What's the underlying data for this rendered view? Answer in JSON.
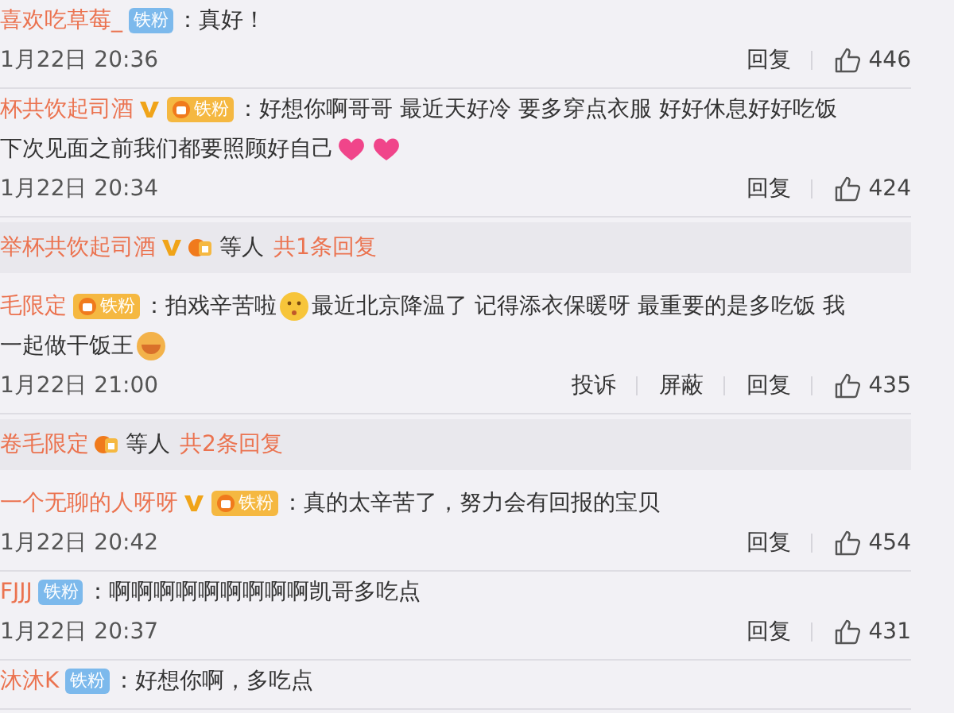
{
  "separator": "：",
  "comments": [
    {
      "kind": "comment",
      "user": "喜欢吃草莓_",
      "verified": false,
      "badge": {
        "kind": "blue",
        "label": "铁粉"
      },
      "lines": [
        [
          {
            "kind": "text",
            "text": "真好！"
          }
        ]
      ],
      "time": "1月22日 20:36",
      "actions": [
        "回复"
      ],
      "likes": "446"
    },
    {
      "kind": "comment",
      "user": "杯共饮起司酒",
      "verified": true,
      "badge": {
        "kind": "gold",
        "label": "铁粉"
      },
      "lines": [
        [
          {
            "kind": "text",
            "text": "好想你啊哥哥 最近天好冷 要多穿点衣服 好好休息好好吃饭"
          }
        ],
        [
          {
            "kind": "text",
            "text": "下次见面之前我们都要照顾好自己"
          },
          {
            "kind": "heart"
          },
          {
            "kind": "heart"
          }
        ]
      ],
      "time": "1月22日 20:34",
      "actions": [
        "回复"
      ],
      "likes": "424"
    },
    {
      "kind": "summary",
      "user": "举杯共饮起司酒",
      "verified": true,
      "others": "等人",
      "count": "共1条回复"
    },
    {
      "kind": "comment",
      "user": "毛限定",
      "verified": false,
      "badge": {
        "kind": "gold",
        "label": "铁粉"
      },
      "lines": [
        [
          {
            "kind": "text",
            "text": "拍戏辛苦啦"
          },
          {
            "kind": "kiss"
          },
          {
            "kind": "text",
            "text": "最近北京降温了 记得添衣保暖呀 最重要的是多吃饭 我"
          }
        ],
        [
          {
            "kind": "text",
            "text": "一起做干饭王"
          },
          {
            "kind": "rice"
          }
        ]
      ],
      "time": "1月22日 21:00",
      "actions": [
        "投诉",
        "屏蔽",
        "回复"
      ],
      "likes": "435"
    },
    {
      "kind": "summary",
      "user": "卷毛限定",
      "verified": false,
      "others": "等人",
      "count": "共2条回复"
    },
    {
      "kind": "comment",
      "user": "一个无聊的人呀呀",
      "verified": true,
      "badge": {
        "kind": "gold",
        "label": "铁粉"
      },
      "lines": [
        [
          {
            "kind": "text",
            "text": "真的太辛苦了，努力会有回报的宝贝"
          }
        ]
      ],
      "time": "1月22日 20:42",
      "actions": [
        "回复"
      ],
      "likes": "454"
    },
    {
      "kind": "comment",
      "user": "FJJJ",
      "verified": false,
      "badge": {
        "kind": "blue",
        "label": "铁粉"
      },
      "lines": [
        [
          {
            "kind": "text",
            "text": "啊啊啊啊啊啊啊啊啊凯哥多吃点"
          }
        ]
      ],
      "time": "1月22日 20:37",
      "actions": [
        "回复"
      ],
      "likes": "431"
    },
    {
      "kind": "comment",
      "user": "沐沐K",
      "verified": false,
      "badge": {
        "kind": "blue",
        "label": "铁粉"
      },
      "lines": [
        [
          {
            "kind": "text",
            "text": "好想你啊，多吃点"
          }
        ]
      ]
    }
  ]
}
